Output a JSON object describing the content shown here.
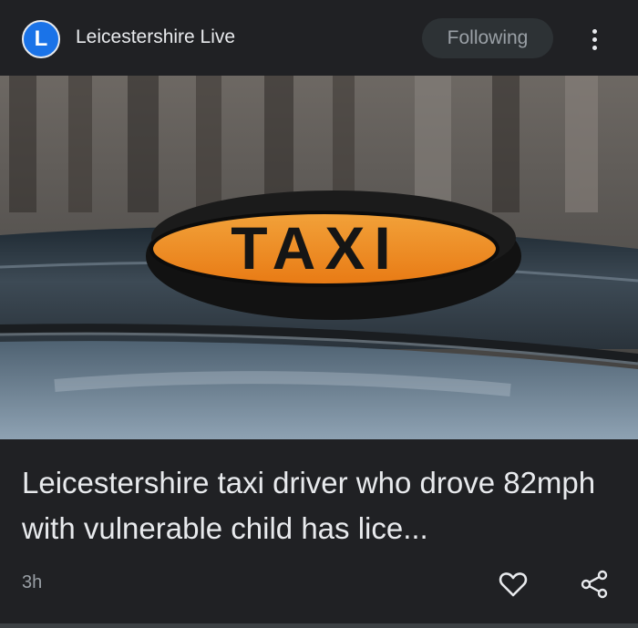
{
  "header": {
    "logo_letter": "L",
    "source_name": "Leicestershire Live",
    "follow_label": "Following"
  },
  "image": {
    "sign_text": "TAXI"
  },
  "article": {
    "headline": "Leicestershire taxi driver who drove 82mph with vulnerable child has lice...",
    "time": "3h"
  },
  "colors": {
    "background": "#202124",
    "text": "#e8eaed",
    "muted": "#9aa0a6",
    "logo": "#1a73e8",
    "button": "#2d3235"
  }
}
